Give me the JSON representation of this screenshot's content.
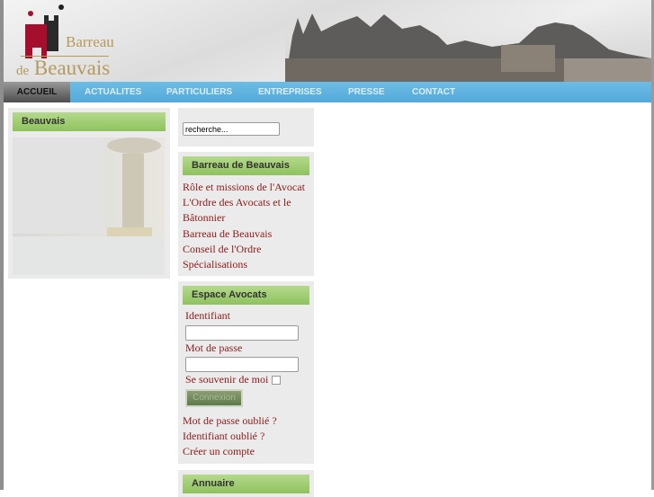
{
  "header": {
    "logo_line1": "Barreau",
    "logo_line2_prefix": "de",
    "logo_line2": "Beauvais"
  },
  "nav": {
    "items": [
      "ACCUEIL",
      "ACTUALITES",
      "PARTICULIERS",
      "ENTREPRISES",
      "PRESSE",
      "CONTACT"
    ],
    "active": "ACCUEIL"
  },
  "left": {
    "title": "Beauvais"
  },
  "search": {
    "placeholder": "recherche..."
  },
  "barreau": {
    "title": "Barreau de Beauvais",
    "links": [
      "Rôle et missions de l'Avocat",
      "L'Ordre des Avocats et le",
      "Bâtonnier",
      "Barreau de Beauvais",
      "Conseil de l'Ordre",
      "Spécialisations"
    ]
  },
  "login": {
    "title": "Espace Avocats",
    "username_label": "Identifiant",
    "password_label": "Mot de passe",
    "remember_label": "Se souvenir de moi",
    "submit": "Connexion",
    "links": [
      "Mot de passe oublié ?",
      "Identifiant oublié ?",
      "Créer un compte"
    ]
  },
  "annuaire": {
    "title": "Annuaire"
  },
  "colors": {
    "nav": "#5aafdc",
    "green_header": "#9ccb6f",
    "link": "#8b1a1a",
    "logo_gold": "#b49a5e",
    "logo_red": "#a50f2d"
  }
}
